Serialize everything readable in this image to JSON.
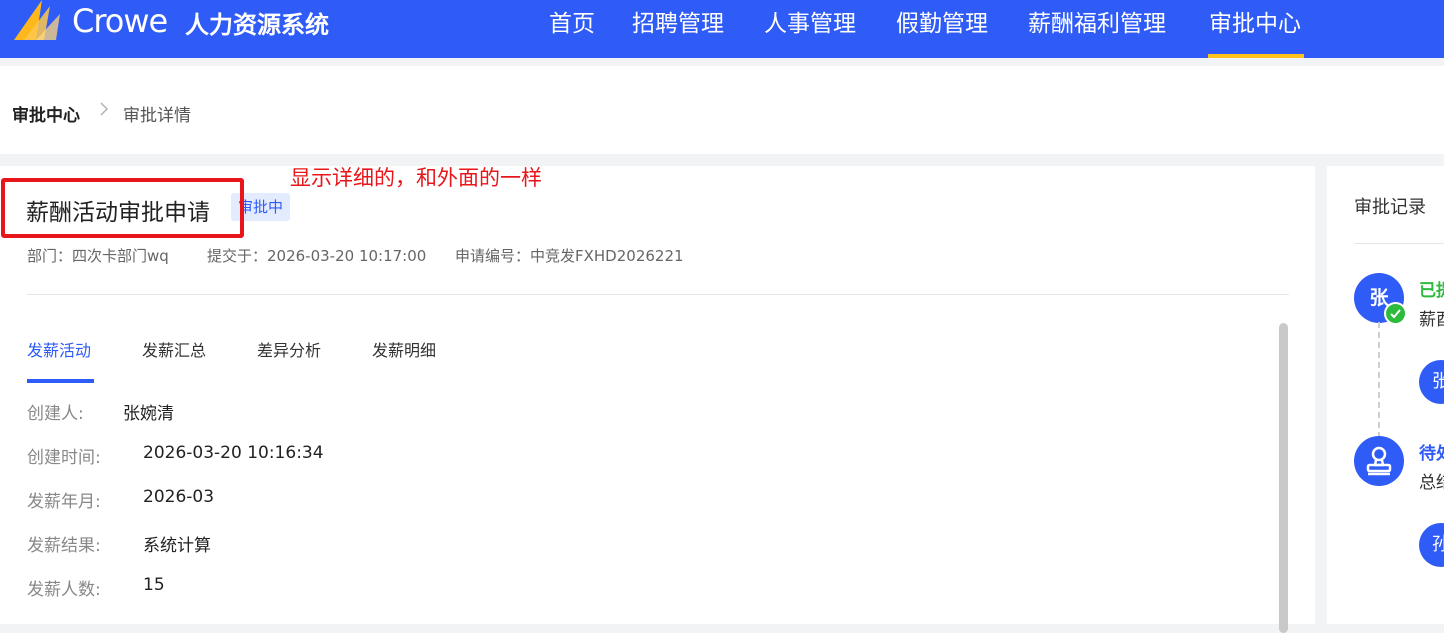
{
  "header": {
    "logo_text": "Crowe",
    "system_name": "人力资源系统",
    "nav": [
      "首页",
      "招聘管理",
      "人事管理",
      "假勤管理",
      "薪酬福利管理",
      "审批中心"
    ],
    "active_nav": "审批中心"
  },
  "breadcrumb": {
    "root": "审批中心",
    "separator": ">",
    "current": "审批详情"
  },
  "detail": {
    "title": "薪酬活动审批申请",
    "status": "审批中",
    "annotation": "显示详细的，和外面的一样",
    "meta": {
      "department": "部门：四次卡部门wq",
      "submitted": "提交于：2026-03-20 10:17:00",
      "application_no": "申请编号：中竞发FXHD2026221"
    },
    "tabs": [
      "发薪活动",
      "发薪汇总",
      "差异分析",
      "发薪明细"
    ],
    "active_tab": "发薪活动",
    "fields": [
      {
        "label": "创建人:",
        "value": "张婉清"
      },
      {
        "label": "创建时间:",
        "value": "2026-03-20 10:16:34"
      },
      {
        "label": "发薪年月:",
        "value": "2026-03"
      },
      {
        "label": "发薪结果:",
        "value": "系统计算"
      },
      {
        "label": "发薪人数:",
        "value": "15"
      }
    ]
  },
  "approval_record": {
    "title": "审批记录",
    "nodes": [
      {
        "avatar": "张",
        "status": "已提",
        "text": "薪酉",
        "sub_avatar": "张",
        "status_color": "#2dbb3d"
      },
      {
        "avatar_icon": "stamp-icon",
        "status": "待处",
        "text": "总结",
        "sub_avatar": "孙",
        "status_color": "#2f5bf6"
      }
    ]
  },
  "colors": {
    "primary": "#2f5bf6",
    "accent_underline": "#ffc21a",
    "annotation_red": "#e8161a",
    "approved_green": "#2dbb3d"
  }
}
